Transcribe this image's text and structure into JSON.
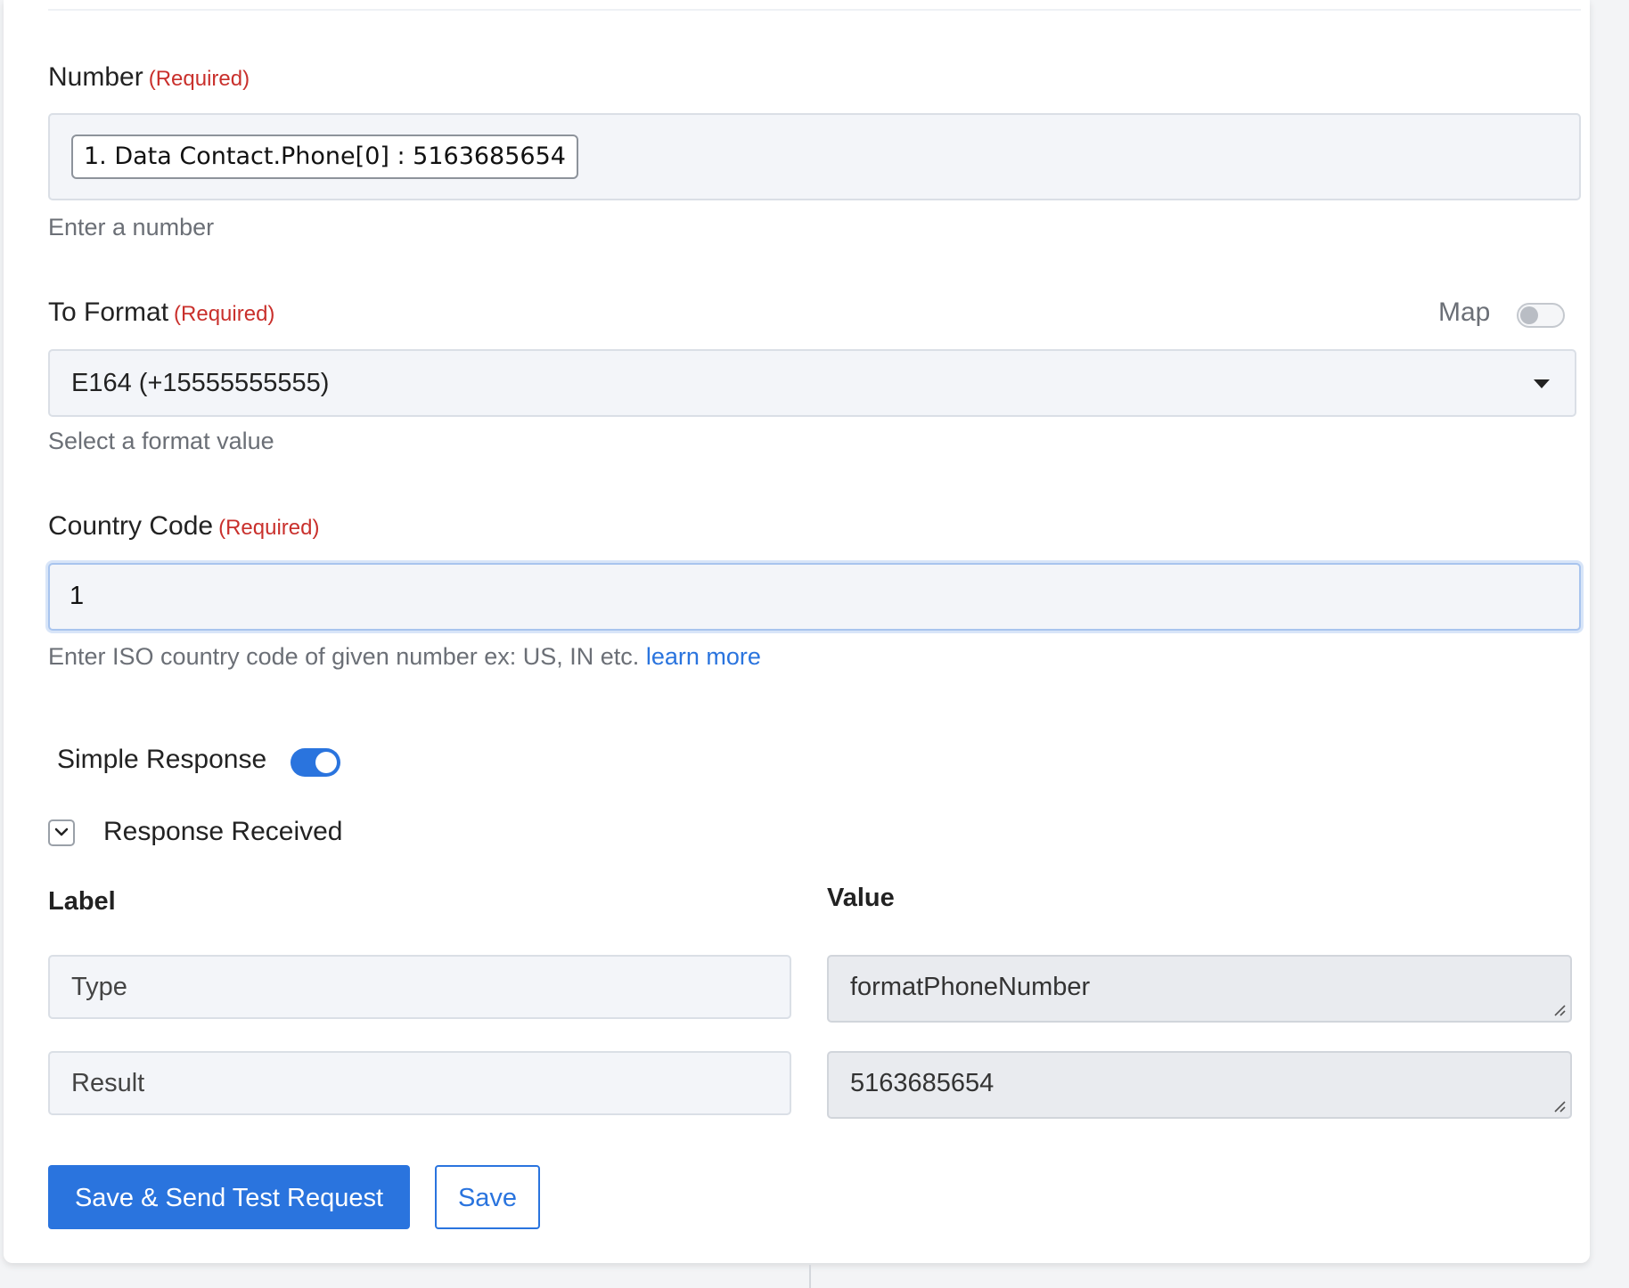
{
  "number_field": {
    "label": "Number",
    "required": "(Required)",
    "chip_text": "1. Data Contact.Phone[0] : 5163685654",
    "help": "Enter a number"
  },
  "format_field": {
    "label": "To Format",
    "required": "(Required)",
    "map_label": "Map",
    "map_toggle_on": false,
    "selected": "E164 (+15555555555)",
    "help": "Select a format value"
  },
  "country_field": {
    "label": "Country Code",
    "required": "(Required)",
    "value": "1",
    "help": "Enter ISO country code of given number ex: US, IN etc.",
    "help_link": "learn more"
  },
  "simple_response": {
    "label": "Simple Response",
    "toggle_on": true
  },
  "response_received": {
    "label": "Response Received",
    "label_col": "Label",
    "value_col": "Value",
    "rows": [
      {
        "label": "Type",
        "value": "formatPhoneNumber"
      },
      {
        "label": "Result",
        "value": "5163685654"
      }
    ]
  },
  "actions": {
    "save_send": "Save & Send Test Request",
    "save": "Save"
  },
  "colors": {
    "accent": "#2a74de",
    "required": "#c9302c"
  }
}
